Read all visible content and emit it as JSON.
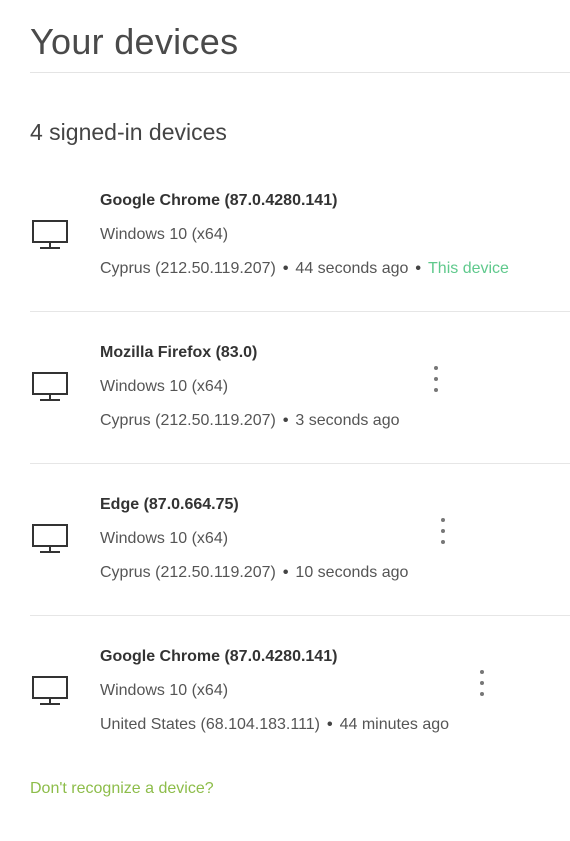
{
  "page": {
    "title": "Your devices",
    "count_heading": "4 signed-in devices"
  },
  "devices": [
    {
      "browser": "Google Chrome (87.0.4280.141)",
      "os": "Windows 10 (x64)",
      "location": "Cyprus (212.50.119.207)",
      "last_seen": "44 seconds ago",
      "current_label": "This device",
      "icon": "monitor-icon"
    },
    {
      "browser": "Mozilla Firefox (83.0)",
      "os": "Windows 10 (x64)",
      "location": "Cyprus (212.50.119.207)",
      "last_seen": "3 seconds ago",
      "icon": "monitor-icon"
    },
    {
      "browser": "Edge (87.0.664.75)",
      "os": "Windows 10 (x64)",
      "location": "Cyprus (212.50.119.207)",
      "last_seen": "10 seconds ago",
      "icon": "monitor-icon"
    },
    {
      "browser": "Google Chrome (87.0.4280.141)",
      "os": "Windows 10 (x64)",
      "location": "United States (68.104.183.111)",
      "last_seen": "44 minutes ago",
      "icon": "monitor-icon"
    }
  ],
  "separator": "•",
  "footer": {
    "help_link": "Don't recognize a device?"
  },
  "colors": {
    "current_device": "#5fc98c",
    "link": "#8dbd4a",
    "text": "#333333",
    "divider": "#e6e6e6"
  }
}
